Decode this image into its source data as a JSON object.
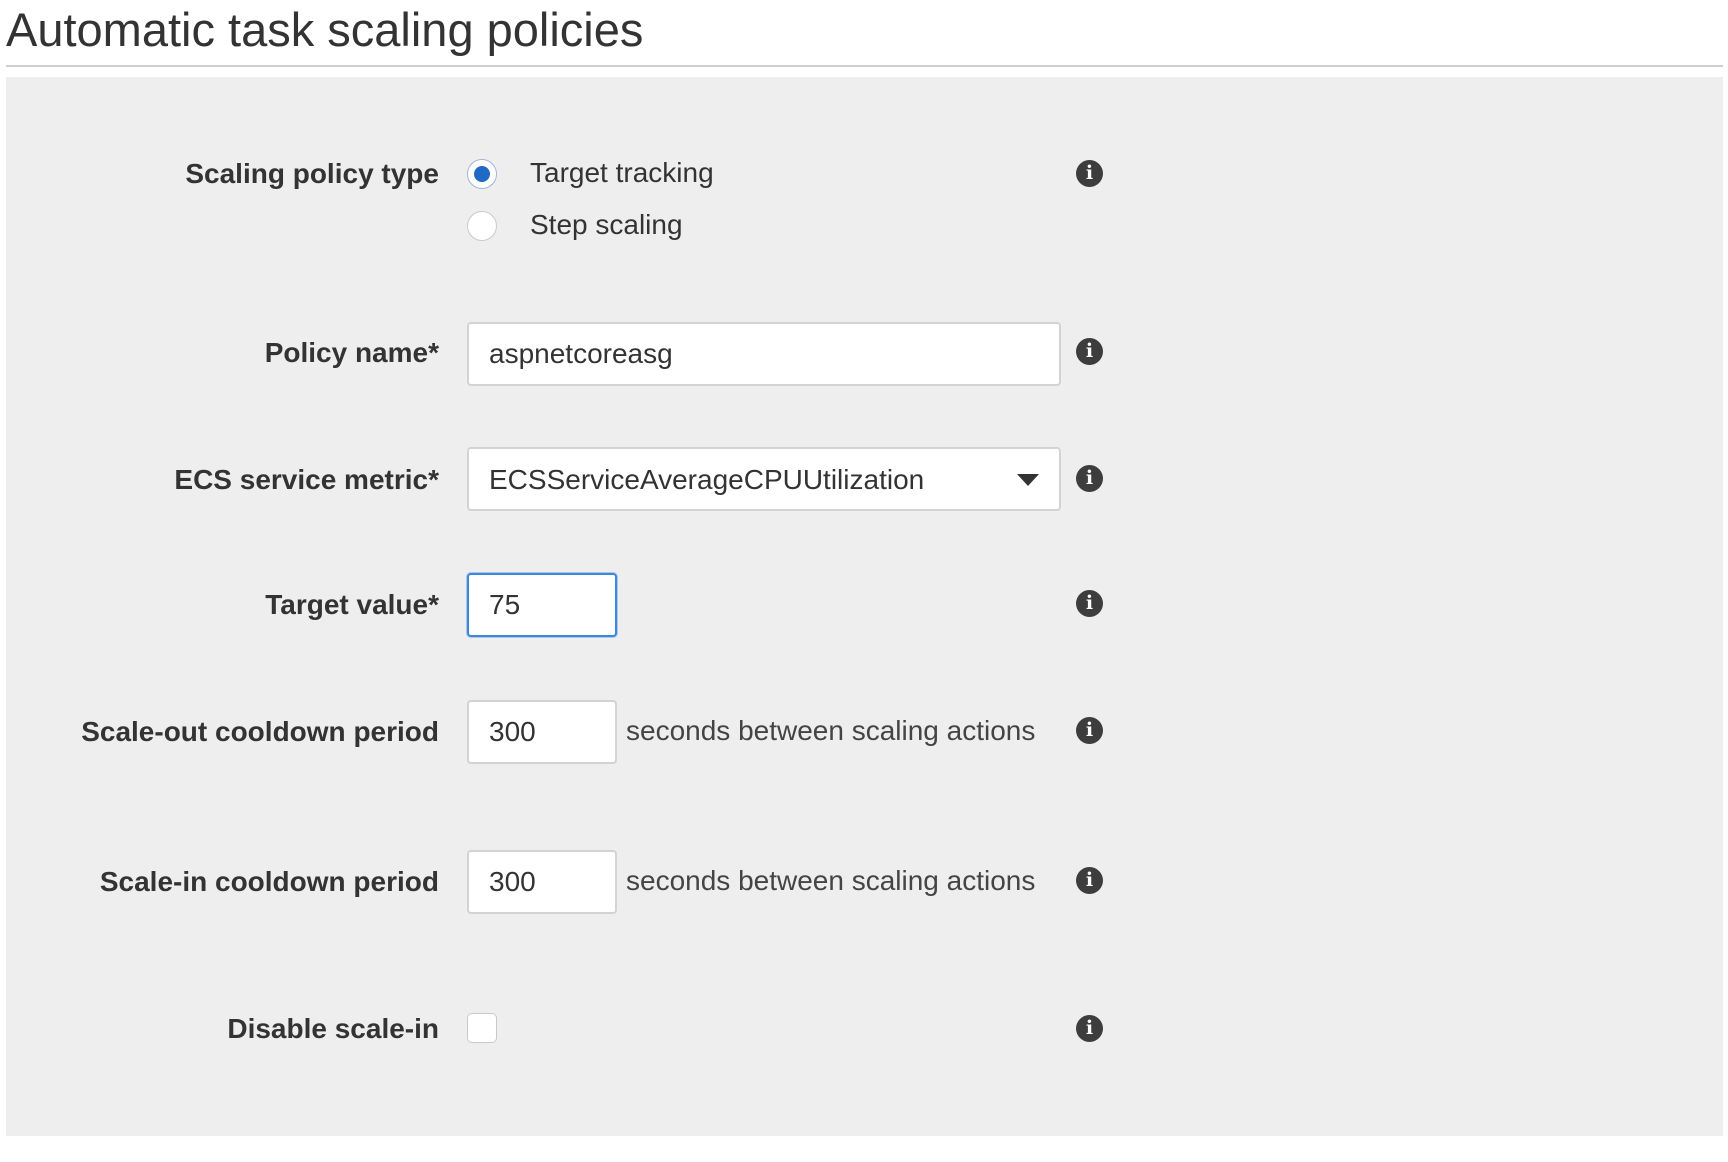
{
  "section": {
    "title": "Automatic task scaling policies"
  },
  "form": {
    "scaling_policy_type": {
      "label": "Scaling policy type",
      "options": [
        "Target tracking",
        "Step scaling"
      ],
      "selected": "Target tracking"
    },
    "policy_name": {
      "label": "Policy name*",
      "value": "aspnetcoreasg"
    },
    "ecs_service_metric": {
      "label": "ECS service metric*",
      "value": "ECSServiceAverageCPUUtilization"
    },
    "target_value": {
      "label": "Target value*",
      "value": "75"
    },
    "scale_out_cooldown": {
      "label": "Scale-out cooldown period",
      "value": "300",
      "suffix": "seconds between scaling actions"
    },
    "scale_in_cooldown": {
      "label": "Scale-in cooldown period",
      "value": "300",
      "suffix": "seconds between scaling actions"
    },
    "disable_scale_in": {
      "label": "Disable scale-in",
      "checked": false
    }
  },
  "icons": {
    "info": "info-icon",
    "info_glyph": "i"
  },
  "colors": {
    "panel_background": "#eeeeee",
    "radio_selected": "#1f6ac4",
    "focus_border": "#3f87d9"
  }
}
